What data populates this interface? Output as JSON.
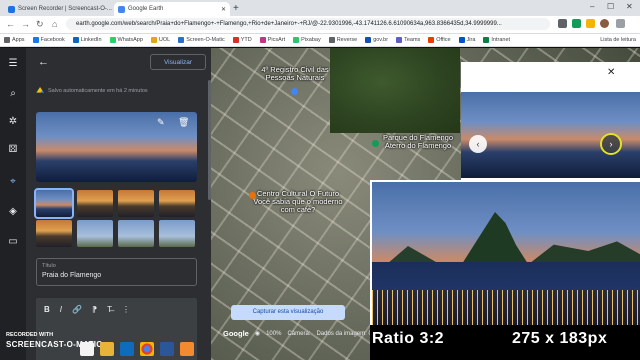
{
  "browser": {
    "tabs": [
      {
        "label": "Screen Recorder | Screencast-O-...",
        "favicon_color": "#1a73e8"
      },
      {
        "label": "Google Earth",
        "favicon_color": "#4285f4"
      }
    ],
    "new_tab_label": "+",
    "url": "earth.google.com/web/search/Praia+do+Flamengo+-+Flamengo,+Rio+de+Janeiro+-+RJ/@-22.9301996,-43.1741126.6.61090634a,963.8366435d,34.9999999...",
    "window_controls": {
      "minimize": "–",
      "maximize": "☐",
      "close": "✕"
    }
  },
  "bookmarks": {
    "items": [
      {
        "label": "Apps",
        "color": "#5f6368"
      },
      {
        "label": "Facebook",
        "color": "#1877f2"
      },
      {
        "label": "LinkedIn",
        "color": "#0a66c2"
      },
      {
        "label": "WhatsApp",
        "color": "#25d366"
      },
      {
        "label": "UOL",
        "color": "#e8a317"
      },
      {
        "label": "Screen-O-Matic",
        "color": "#2c6ecb"
      },
      {
        "label": "YTD",
        "color": "#d93025"
      },
      {
        "label": "PicsArt",
        "color": "#c13584"
      },
      {
        "label": "Pixabay",
        "color": "#2ec66d"
      },
      {
        "label": "Reverse",
        "color": "#5f6368"
      },
      {
        "label": "gov.br",
        "color": "#1351b4"
      },
      {
        "label": "Teams",
        "color": "#5b5fc7"
      },
      {
        "label": "Office",
        "color": "#eb3c00"
      },
      {
        "label": "Jira",
        "color": "#0052cc"
      },
      {
        "label": "Intranet",
        "color": "#0b8043"
      }
    ],
    "reading_list": "Lista de leitura"
  },
  "editor": {
    "visualize_button": "Visualizar",
    "autosave_text": "Salvo automaticamente em há 2 minutos",
    "title_label": "Título",
    "title_value": "Praia do Flamengo",
    "toolbar": {
      "bold": "B",
      "italic": "I",
      "link": "🔗",
      "list": "⁋",
      "clear": "T̶",
      "more": "⋮"
    }
  },
  "map": {
    "labels": {
      "registry": "4º Registro Civil das Pessoas Naturais",
      "park": "Parque do Flamengo Aterro do Flamengo",
      "center": "Centro Cultural O Futuro Você sabia que o moderno com café?"
    },
    "capture_button": "Capturar esta visualização",
    "footer": {
      "logo": "Google",
      "zoom": "100%",
      "camera": "Câmera:",
      "data_text": "Dados da imagem: 06/12/2..."
    }
  },
  "slideshow": {
    "close": "✕",
    "prev": "‹",
    "next": "›"
  },
  "preview": {
    "ratio": "Ratio 3:2",
    "size": "275 x 183px"
  },
  "watermark": {
    "line1": "RECORDED WITH",
    "line2": "SCREENCAST-O-MATIC"
  },
  "taskbar": {
    "icons": [
      {
        "name": "start",
        "color": "#f3f3f3"
      },
      {
        "name": "file-explorer",
        "color": "#e8b339"
      },
      {
        "name": "outlook",
        "color": "#0f6cbd"
      },
      {
        "name": "chrome",
        "color": "#eeeeee"
      },
      {
        "name": "word",
        "color": "#2b579a"
      },
      {
        "name": "screencast",
        "color": "#f28b30"
      }
    ]
  }
}
